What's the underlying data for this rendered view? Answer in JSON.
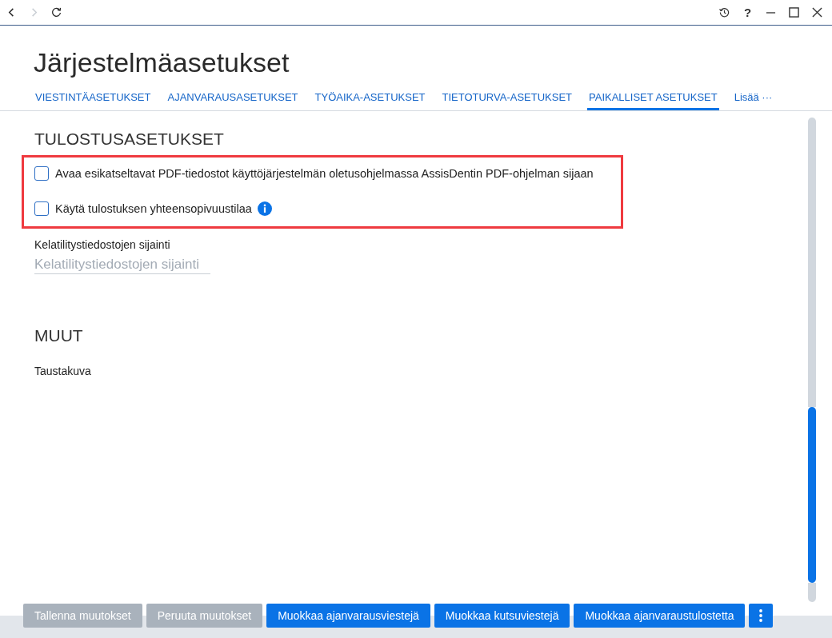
{
  "toolbar": {
    "nav": [
      {
        "kind": "back",
        "disabled": false
      },
      {
        "kind": "forward",
        "disabled": true
      },
      {
        "kind": "reload",
        "disabled": false
      }
    ],
    "help_label": "?"
  },
  "title": "Järjestelmäasetukset",
  "tabs": [
    {
      "label": "VIESTINTÄASETUKSET",
      "selected": false
    },
    {
      "label": "AJANVARAUSASETUKSET",
      "selected": false
    },
    {
      "label": "TYÖAIKA-ASETUKSET",
      "selected": false
    },
    {
      "label": "TIETOTURVA-ASETUKSET",
      "selected": false
    },
    {
      "label": "PAIKALLISET ASETUKSET",
      "selected": true
    }
  ],
  "tabs_more": "Lisää ···",
  "sections": [
    {
      "heading": "TULOSTUSASETUKSET",
      "options": {
        "highlighted": true,
        "items": [
          {
            "label": "Avaa esikatseltavat PDF-tiedostot käyttöjärjestelmän oletusohjelmassa AssisDentin PDF-ohjelman sijaan",
            "checked": false,
            "info": false
          },
          {
            "label": "Käytä tulostuksen yhteensopivuustilaa",
            "checked": false,
            "info": true
          }
        ]
      },
      "fields": [
        {
          "label": "Kelatilitystiedostojen sijainti",
          "placeholder": "Kelatilitystiedostojen sijainti"
        }
      ]
    },
    {
      "heading": "MUUT",
      "fields": [
        {
          "label": "Taustakuva"
        }
      ]
    }
  ],
  "footer": {
    "buttons": [
      {
        "kind": "text",
        "label": "Tallenna muutokset",
        "disabled": true
      },
      {
        "kind": "text",
        "label": "Peruuta muutokset",
        "disabled": true
      },
      {
        "kind": "text",
        "label": "Muokkaa ajanvarausviestejä",
        "disabled": false
      },
      {
        "kind": "text",
        "label": "Muokkaa kutsuviestejä",
        "disabled": false
      },
      {
        "kind": "text",
        "label": "Muokkaa ajanvaraustulostetta",
        "disabled": false
      },
      {
        "kind": "menu",
        "disabled": false
      }
    ]
  }
}
